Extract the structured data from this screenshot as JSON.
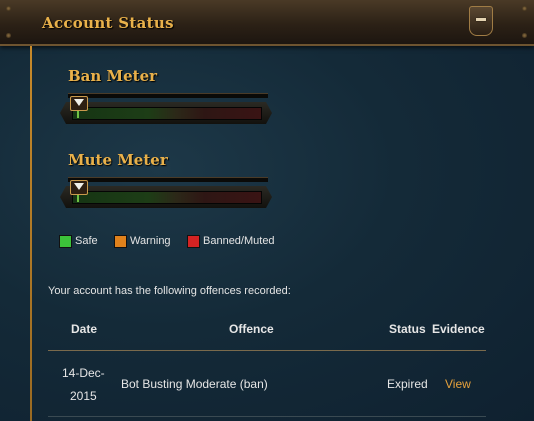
{
  "panel": {
    "title": "Account Status"
  },
  "ban_meter": {
    "heading": "Ban Meter",
    "level_fraction": 0.03
  },
  "mute_meter": {
    "heading": "Mute Meter",
    "level_fraction": 0.03
  },
  "legend": [
    {
      "label": "Safe",
      "color": "#3cc23a"
    },
    {
      "label": "Warning",
      "color": "#e0821c"
    },
    {
      "label": "Banned/Muted",
      "color": "#d42323"
    }
  ],
  "offences": {
    "intro": "Your account has the following offences recorded:",
    "columns": {
      "date": "Date",
      "offence": "Offence",
      "status": "Status",
      "evidence": "Evidence"
    },
    "rows": [
      {
        "date_line1": "14-Dec-",
        "date_line2": "2015",
        "offence": "Bot Busting Moderate (ban)",
        "status": "Expired",
        "evidence": "View"
      }
    ]
  },
  "colors": {
    "heading_gold": "#e9b14a",
    "link_orange": "#e7a23c",
    "panel_bg": "#142a38"
  }
}
